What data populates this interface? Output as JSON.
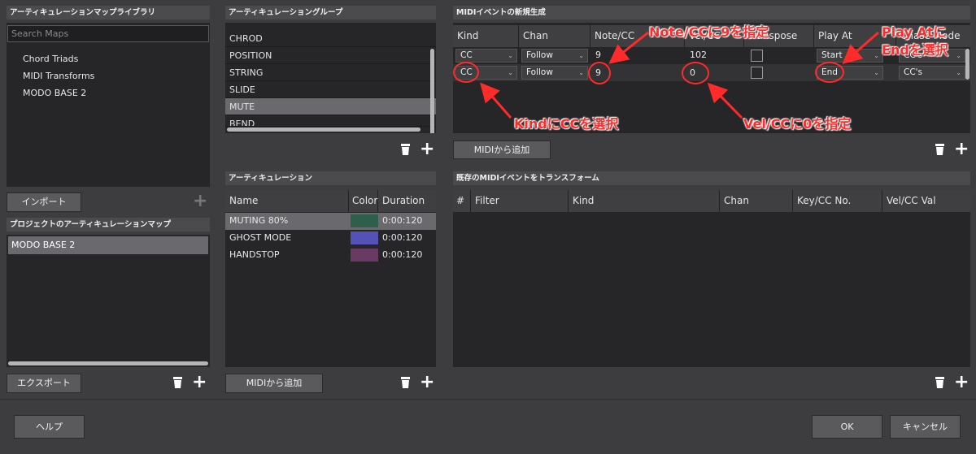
{
  "library": {
    "title": "アーティキュレーションマップライブラリ",
    "search_placeholder": "Search Maps",
    "items": [
      "Chord Triads",
      "MIDI Transforms",
      "MODO BASE 2"
    ],
    "import_label": "インポート"
  },
  "project": {
    "title": "プロジェクトのアーティキュレーションマップ",
    "items": [
      "MODO BASE 2"
    ],
    "export_label": "エクスポート"
  },
  "groups": {
    "title": "アーティキュレーショングループ",
    "items": [
      "CHROD",
      "POSITION",
      "STRING",
      "SLIDE",
      "MUTE",
      "BEND"
    ],
    "selected_index": 4
  },
  "articulation": {
    "title": "アーティキュレーション",
    "columns": [
      "Name",
      "Color",
      "Duration"
    ],
    "rows": [
      {
        "name": "MUTING 80%",
        "color": "#2f5e4a",
        "duration": "0:00:120"
      },
      {
        "name": "GHOST MODE",
        "color": "#5452b6",
        "duration": "0:00:120"
      },
      {
        "name": "HANDSTOP",
        "color": "#6a3a64",
        "duration": "0:00:120"
      }
    ],
    "add_midi_label": "MIDIから追加"
  },
  "midi_new": {
    "title": "MIDIイベントの新規生成",
    "columns": [
      "Kind",
      "Chan",
      "Note/CC",
      "Vel/CC",
      "Transpose",
      "Play At",
      "Chase Mode"
    ],
    "rows": [
      {
        "kind": "CC",
        "chan": "Follow",
        "note": "9",
        "vel": "102",
        "play_at": "Start",
        "chase": "CC's"
      },
      {
        "kind": "CC",
        "chan": "Follow",
        "note": "9",
        "vel": "0",
        "play_at": "End",
        "chase": "CC's"
      }
    ],
    "add_midi_label": "MIDIから追加"
  },
  "transform": {
    "title": "既存のMIDIイベントをトランスフォーム",
    "columns": [
      "#",
      "Filter",
      "Kind",
      "Chan",
      "Key/CC No.",
      "Vel/CC Val"
    ]
  },
  "footer": {
    "help_label": "ヘルプ",
    "ok_label": "OK",
    "cancel_label": "キャンセル"
  },
  "annotations": {
    "note_cc": "Note/CCに9を指定",
    "play_at_1": "Play Atに",
    "play_at_2": "Endを選択",
    "kind_cc": "KindにCCを選択",
    "vel_cc": "Vel/CCに0を指定"
  },
  "colors": {
    "annotation": "#ff2a2a",
    "selected_row": "#6a6a6e",
    "panel_bg": "#262628"
  }
}
